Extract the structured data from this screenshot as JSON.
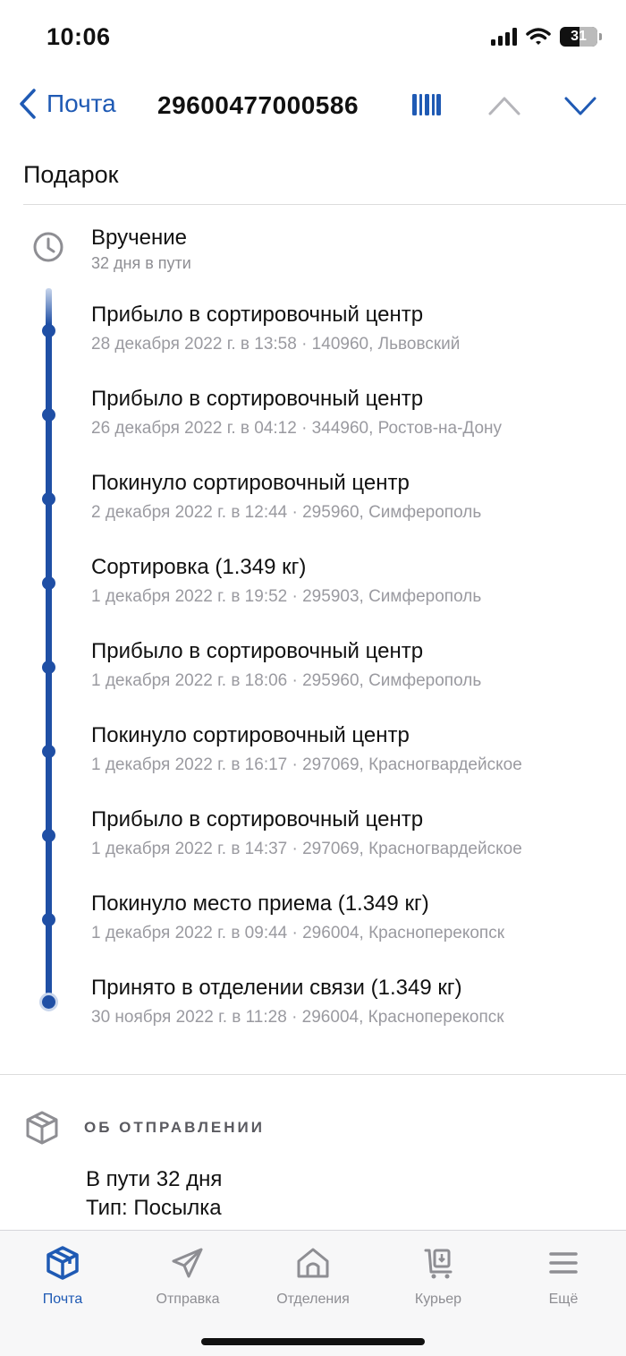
{
  "status_bar": {
    "time": "10:06",
    "battery": "31"
  },
  "nav": {
    "back_label": "Почта",
    "title": "29600477000586"
  },
  "section_title": "Подарок",
  "current": {
    "title": "Вручение",
    "subtitle": "32 дня в пути"
  },
  "events": [
    {
      "title": "Прибыло в сортировочный центр",
      "subtitle": "28 декабря 2022 г. в 13:58 · 140960, Львовский"
    },
    {
      "title": "Прибыло в сортировочный центр",
      "subtitle": "26 декабря 2022 г. в 04:12 · 344960, Ростов-на-Дону"
    },
    {
      "title": "Покинуло сортировочный центр",
      "subtitle": "2 декабря 2022 г. в 12:44 · 295960, Симферополь"
    },
    {
      "title": "Сортировка  (1.349 кг)",
      "subtitle": "1 декабря 2022 г. в 19:52 · 295903, Симферополь"
    },
    {
      "title": "Прибыло в сортировочный центр",
      "subtitle": "1 декабря 2022 г. в 18:06 · 295960, Симферополь"
    },
    {
      "title": "Покинуло сортировочный центр",
      "subtitle": "1 декабря 2022 г. в 16:17 · 297069, Красногвардейское"
    },
    {
      "title": "Прибыло в сортировочный центр",
      "subtitle": "1 декабря 2022 г. в 14:37 · 297069, Красногвардейское"
    },
    {
      "title": "Покинуло место приема  (1.349 кг)",
      "subtitle": "1 декабря 2022 г. в 09:44 · 296004, Красноперекопск"
    },
    {
      "title": "Принято в отделении связи  (1.349 кг)",
      "subtitle": "30 ноября 2022 г. в 11:28 · 296004, Красноперекопск"
    }
  ],
  "about": {
    "title": "ОБ ОТПРАВЛЕНИИ",
    "lines": [
      "В пути 32 дня",
      "Тип: Посылка"
    ]
  },
  "tabs": [
    {
      "label": "Почта",
      "icon": "box-icon",
      "active": true
    },
    {
      "label": "Отправка",
      "icon": "send-icon",
      "active": false
    },
    {
      "label": "Отделения",
      "icon": "home-icon",
      "active": false
    },
    {
      "label": "Курьер",
      "icon": "courier-icon",
      "active": false
    },
    {
      "label": "Ещё",
      "icon": "menu-icon",
      "active": false
    }
  ],
  "colors": {
    "accent": "#1f5ab4",
    "timeline": "#1f4fa5",
    "muted": "#9a9aa0"
  }
}
